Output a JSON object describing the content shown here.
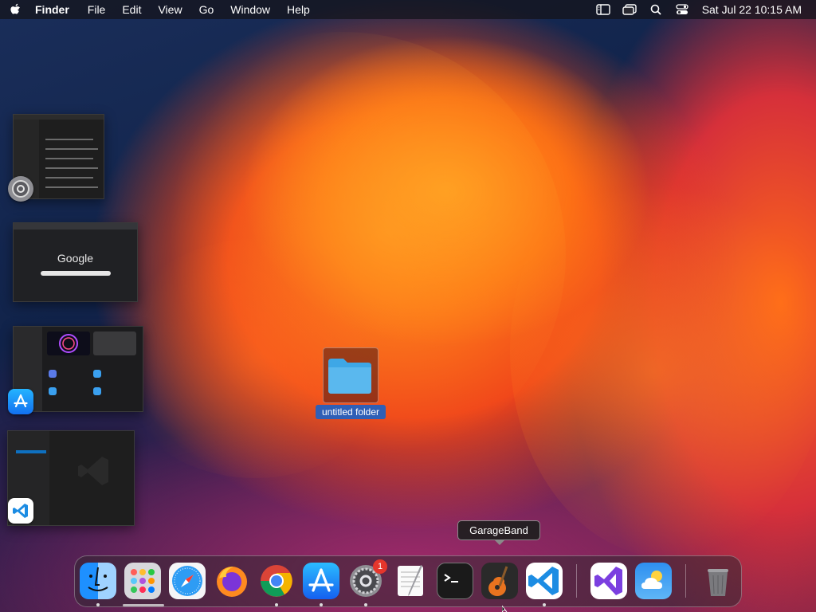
{
  "menubar": {
    "app_name": "Finder",
    "items": [
      "File",
      "Edit",
      "View",
      "Go",
      "Window",
      "Help"
    ],
    "clock": "Sat Jul 22  10:15 AM"
  },
  "thumbnails": {
    "chrome_logo_text": "Google"
  },
  "desktop": {
    "folder_label": "untitled folder"
  },
  "tooltip": {
    "label": "GarageBand"
  },
  "dock": {
    "badge_count": "1",
    "icons": [
      "finder-icon",
      "launchpad-icon",
      "safari-icon",
      "firefox-icon",
      "chrome-icon",
      "app-store-icon",
      "system-settings-icon",
      "textedit-icon",
      "terminal-icon",
      "garageband-icon",
      "vscode-icon",
      "visual-studio-icon",
      "weather-icon",
      "trash-icon"
    ]
  },
  "colors": {
    "folder": "#5ab8ee",
    "selection": "#2f5fb6",
    "badge": "#e5362c"
  }
}
